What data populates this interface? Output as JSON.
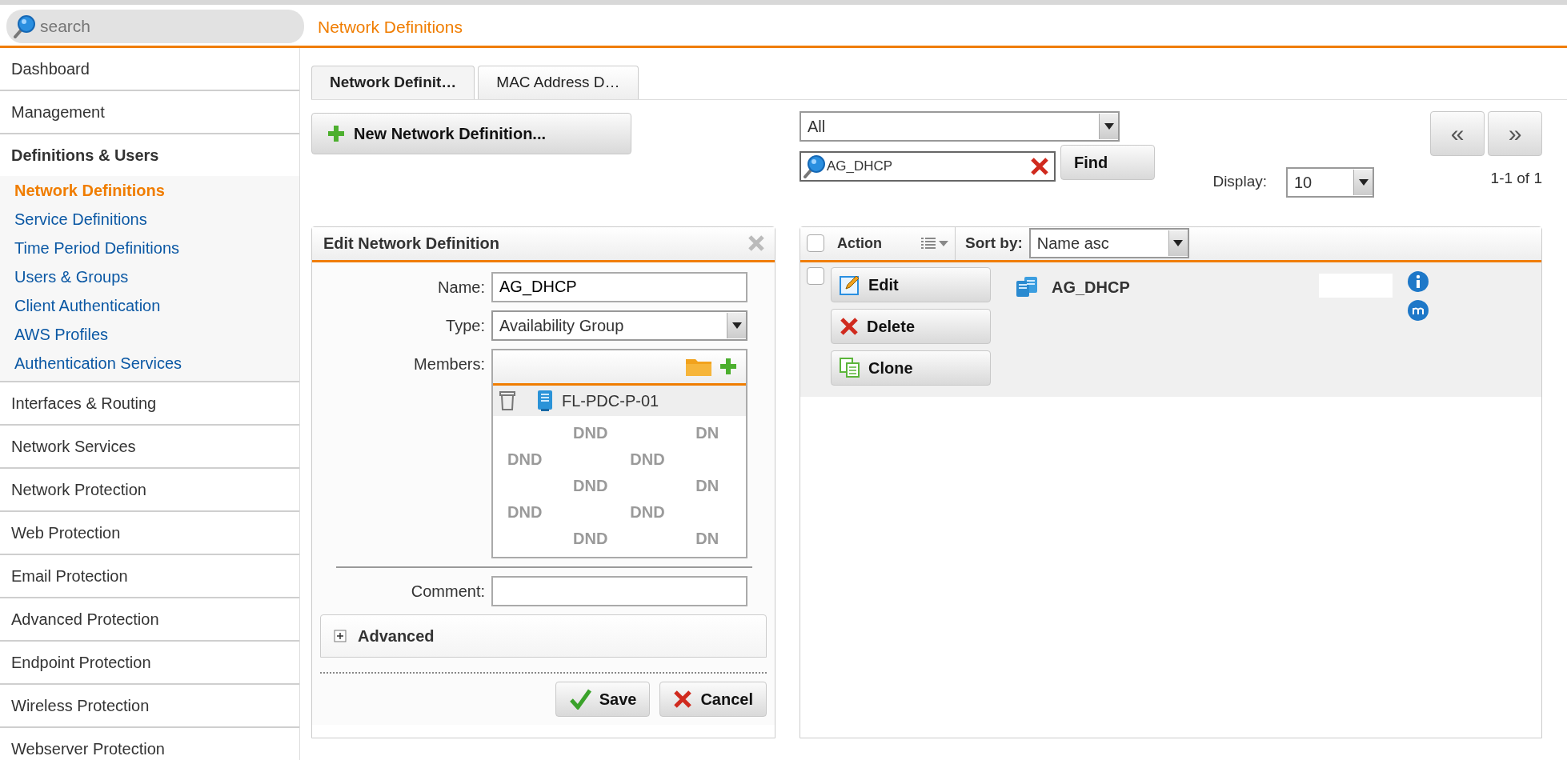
{
  "sidebar": {
    "search": {
      "placeholder": "search"
    },
    "items": [
      {
        "label": "Dashboard",
        "expanded": false
      },
      {
        "label": "Management",
        "expanded": false
      },
      {
        "label": "Definitions & Users",
        "expanded": true,
        "children": [
          {
            "label": "Network Definitions",
            "selected": true
          },
          {
            "label": "Service Definitions",
            "selected": false
          },
          {
            "label": "Time Period Definitions",
            "selected": false
          },
          {
            "label": "Users & Groups",
            "selected": false
          },
          {
            "label": "Client Authentication",
            "selected": false
          },
          {
            "label": "AWS Profiles",
            "selected": false
          },
          {
            "label": "Authentication Services",
            "selected": false
          }
        ]
      },
      {
        "label": "Interfaces & Routing",
        "expanded": false
      },
      {
        "label": "Network Services",
        "expanded": false
      },
      {
        "label": "Network Protection",
        "expanded": false
      },
      {
        "label": "Web Protection",
        "expanded": false
      },
      {
        "label": "Email Protection",
        "expanded": false
      },
      {
        "label": "Advanced Protection",
        "expanded": false
      },
      {
        "label": "Endpoint Protection",
        "expanded": false
      },
      {
        "label": "Wireless Protection",
        "expanded": false
      },
      {
        "label": "Webserver Protection",
        "expanded": false
      }
    ]
  },
  "page_title": "Network Definitions",
  "tabs": [
    {
      "label": "Network Definit…",
      "selected": true
    },
    {
      "label": "MAC Address D…",
      "selected": false
    }
  ],
  "new_button": "New Network Definition...",
  "editor": {
    "title": "Edit Network Definition",
    "fields": [
      {
        "kind": "text",
        "label": "Name:",
        "value": "AG_DHCP"
      },
      {
        "kind": "select",
        "label": "Type:",
        "value": "Availability Group"
      },
      {
        "kind": "members",
        "label": "Members:",
        "members": [
          {
            "name": "FL-PDC-P-01"
          }
        ],
        "drop_hints": [
          [
            "DND",
            "DN"
          ],
          [
            "DND",
            "DND"
          ],
          [
            "DND",
            "DN"
          ],
          [
            "DND",
            "DND"
          ],
          [
            "DND",
            "DN"
          ]
        ]
      },
      {
        "kind": "text",
        "label": "Comment:"
      }
    ],
    "advanced": {
      "label": "Advanced",
      "expanded": false
    },
    "buttons": [
      {
        "kind": "save",
        "label": "Save"
      },
      {
        "kind": "cancel",
        "label": "Cancel"
      }
    ]
  },
  "list": {
    "filter": "All",
    "search": "AG_DHCP",
    "find_button": "Find",
    "display": {
      "label": "Display:",
      "value": "10"
    },
    "pager": [
      "«",
      "»"
    ],
    "range": "1-1 of 1",
    "header": {
      "select_all_checked": false,
      "action": "Action",
      "sort_label": "Sort by:",
      "sort_value": "Name asc"
    },
    "rows": [
      {
        "checked": false,
        "name": "AG_DHCP",
        "actions": [
          {
            "kind": "edit",
            "label": "Edit"
          },
          {
            "kind": "delete",
            "label": "Delete"
          },
          {
            "kind": "clone",
            "label": "Clone"
          }
        ]
      }
    ]
  }
}
